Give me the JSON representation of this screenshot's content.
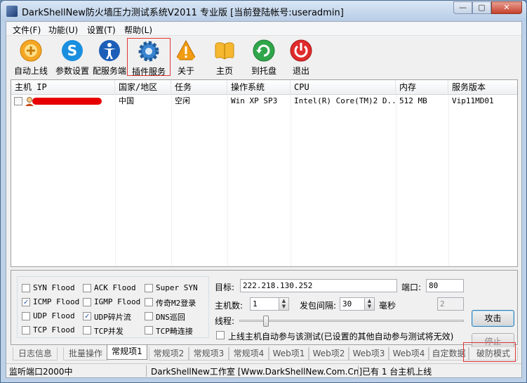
{
  "window": {
    "title": "DarkShellNew防火墙压力测试系统V2011 专业版 [当前登陆帐号:useradmin]",
    "min_glyph": "—",
    "max_glyph": "▢",
    "close_glyph": "✕"
  },
  "menu": [
    "文件(F)",
    "功能(U)",
    "设置(T)",
    "帮助(L)"
  ],
  "toolbar": [
    {
      "label": "自动上线",
      "icon": "gold-circle-icon",
      "color": "#f5a623"
    },
    {
      "label": "参数设置",
      "icon": "skype-icon",
      "color": "#1a8fe0"
    },
    {
      "label": "配服务端",
      "icon": "person-icon",
      "color": "#1d5fb8"
    },
    {
      "label": "插件服务",
      "icon": "gear-icon",
      "color": "#3a84d0"
    },
    {
      "label": "关于",
      "icon": "warning-icon",
      "color": "#f39c12"
    },
    {
      "label": "主页",
      "icon": "book-icon",
      "color": "#f5b82e"
    },
    {
      "label": "到托盘",
      "icon": "recycle-icon",
      "color": "#2fa64a"
    },
    {
      "label": "退出",
      "icon": "power-icon",
      "color": "#e02c2c"
    }
  ],
  "hosts": {
    "columns": [
      "主机 IP",
      "国家/地区",
      "任务",
      "操作系统",
      "CPU",
      "内存",
      "服务版本"
    ],
    "rows": [
      {
        "ip": "",
        "region": "中国",
        "task": "空闲",
        "os": "Win XP SP3",
        "cpu": "Intel(R) Core(TM)2 D...",
        "mem": "512 MB",
        "version": "Vip11MD01"
      }
    ]
  },
  "attacks": [
    {
      "label": "SYN Flood",
      "checked": false
    },
    {
      "label": "ACK Flood",
      "checked": false
    },
    {
      "label": "Super SYN",
      "checked": false
    },
    {
      "label": "ICMP Flood",
      "checked": true
    },
    {
      "label": "IGMP Flood",
      "checked": false
    },
    {
      "label": "传奇M2登录",
      "checked": false
    },
    {
      "label": "UDP Flood",
      "checked": false
    },
    {
      "label": "UDP碎片流",
      "checked": true
    },
    {
      "label": "DNS巡回",
      "checked": false
    },
    {
      "label": "TCP Flood",
      "checked": false
    },
    {
      "label": "TCP并发",
      "checked": false
    },
    {
      "label": "TCP畸连接",
      "checked": false
    }
  ],
  "form": {
    "target_label": "目标:",
    "target_value": "222.218.130.252",
    "port_label": "端口:",
    "port_value": "80",
    "hosts_label": "主机数:",
    "hosts_value": "1",
    "interval_label": "发包间隔:",
    "interval_value": "30",
    "ms_label": "毫秒",
    "threads_label": "线程:",
    "threads_value": "2",
    "thread_level": 0.12,
    "auto_join_label": "上线主机自动参与该测试(已设置的其他自动参与测试将无效)",
    "auto_join_checked": false,
    "attack_button": "攻击",
    "stop_button": "停止",
    "spin_up": "▲",
    "spin_down": "▼"
  },
  "tabs": [
    "日志信息",
    "批量操作",
    "常规项1",
    "常规项2",
    "常规项3",
    "常规项4",
    "Web项1",
    "Web项2",
    "Web项3",
    "Web项4",
    "自定数据",
    "破防模式"
  ],
  "active_tab": 2,
  "status": {
    "port": "监听端口2000中",
    "studio": "DarkShellNew工作室 [Www.DarkShellNew.Com.Cn]",
    "online": "已有 1 台主机上线"
  }
}
